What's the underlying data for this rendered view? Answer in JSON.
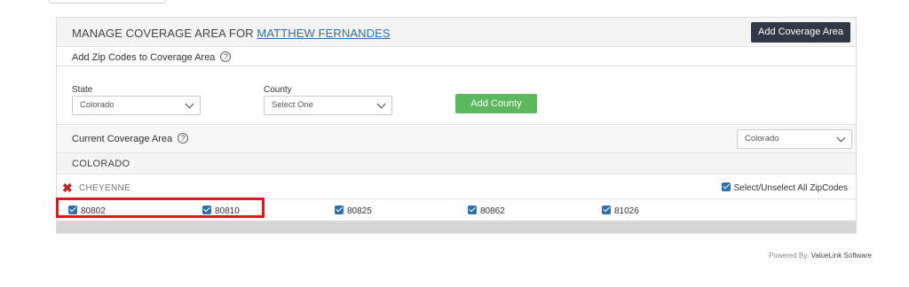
{
  "header": {
    "title_prefix": "MANAGE COVERAGE AREA FOR",
    "user_name": "MATTHEW FERNANDES",
    "add_coverage_label": "Add Coverage Area"
  },
  "zip_section": {
    "label": "Add Zip Codes to Coverage Area",
    "help_glyph": "?"
  },
  "form": {
    "state_label": "State",
    "state_value": "Colorado",
    "county_label": "County",
    "county_value": "Select One",
    "add_county_label": "Add County"
  },
  "current": {
    "label": "Current Coverage Area",
    "help_glyph": "?",
    "filter_value": "Colorado"
  },
  "state_group": {
    "name": "COLORADO",
    "county": "CHEYENNE",
    "remove_glyph": "✖",
    "select_all_label": "Select/Unselect All ZipCodes",
    "zipcodes": [
      "80802",
      "80810",
      "80825",
      "80862",
      "81026"
    ]
  },
  "footer": {
    "powered_prefix": "Powered By:",
    "brand": "ValueLink Software"
  },
  "colors": {
    "primary_dark": "#2f3844",
    "add_county_green": "#5cb85c",
    "link_blue": "#2a6fb0",
    "highlight_red": "#e8131b",
    "remove_red": "#b22222"
  }
}
